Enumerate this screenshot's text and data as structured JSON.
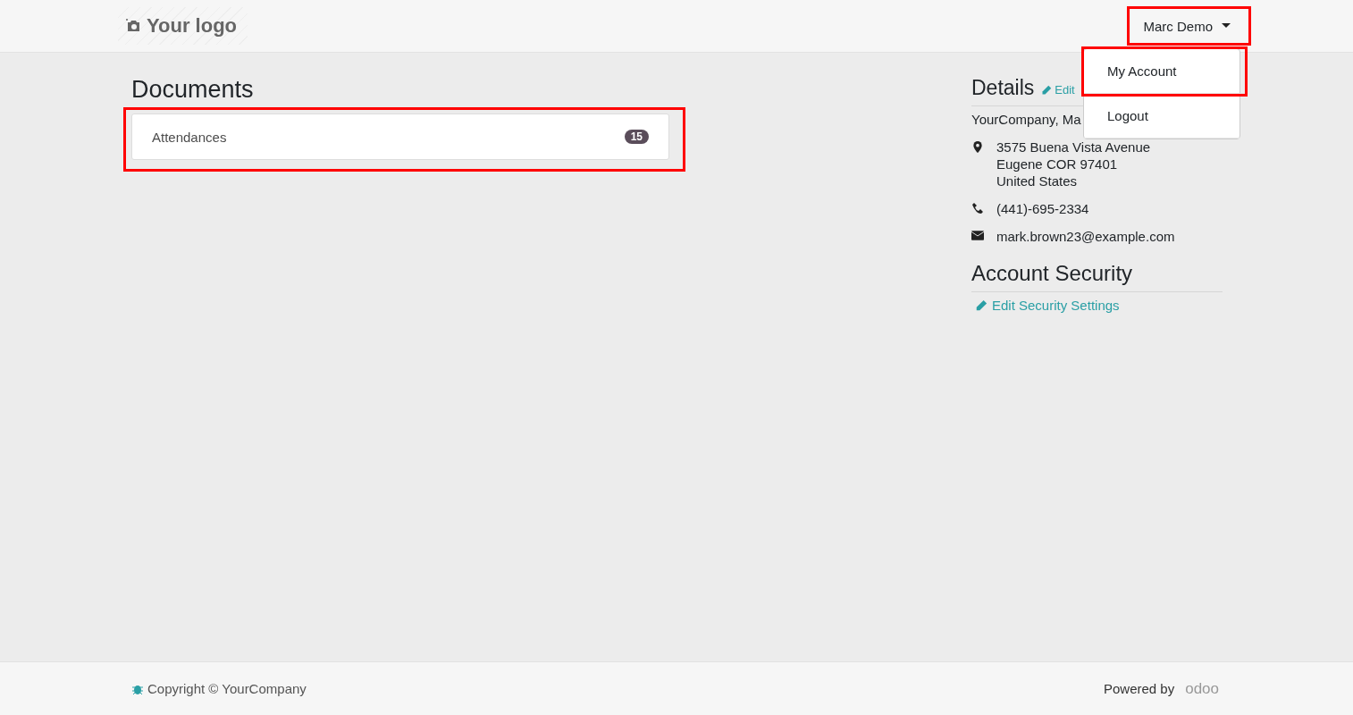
{
  "header": {
    "logo": "Your logo",
    "user_menu": {
      "label": "Marc Demo",
      "expanded": true,
      "highlighted": true,
      "items": [
        {
          "label": "My Account",
          "highlighted": true
        },
        {
          "label": "Logout",
          "highlighted": false
        }
      ]
    }
  },
  "documents": {
    "title": "Documents",
    "highlighted": true,
    "items": [
      {
        "label": "Attendances",
        "count": "15"
      }
    ]
  },
  "details": {
    "title": "Details",
    "edit_link": "Edit",
    "company": "YourCompany, Ma",
    "address": [
      "3575 Buena Vista Avenue",
      "Eugene COR 97401",
      "United States"
    ],
    "phone": "(441)-695-2334",
    "email": "mark.brown23@example.com"
  },
  "security": {
    "title": "Account Security",
    "link": "Edit Security Settings"
  },
  "footer": {
    "copyright": "Copyright © YourCompany",
    "powered_by": "Powered by",
    "brand": "odoo"
  }
}
